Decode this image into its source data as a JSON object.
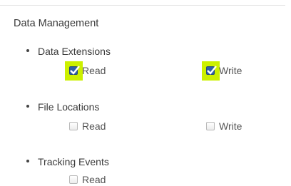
{
  "section": {
    "title": "Data Management"
  },
  "items": [
    {
      "label": "Data Extensions",
      "read": {
        "label": "Read",
        "checked": true,
        "highlighted": true
      },
      "write": {
        "label": "Write",
        "checked": true,
        "highlighted": true
      }
    },
    {
      "label": "File Locations",
      "read": {
        "label": "Read",
        "checked": false,
        "highlighted": false
      },
      "write": {
        "label": "Write",
        "checked": false,
        "highlighted": false
      }
    },
    {
      "label": "Tracking Events",
      "read": {
        "label": "Read",
        "checked": false,
        "highlighted": false
      }
    }
  ],
  "colors": {
    "highlight": "#ccf000",
    "checkbox_checked": "#2f5fa8"
  },
  "icons": {
    "bullet": "bullet-dot-icon",
    "checkmark": "checkmark-icon"
  }
}
